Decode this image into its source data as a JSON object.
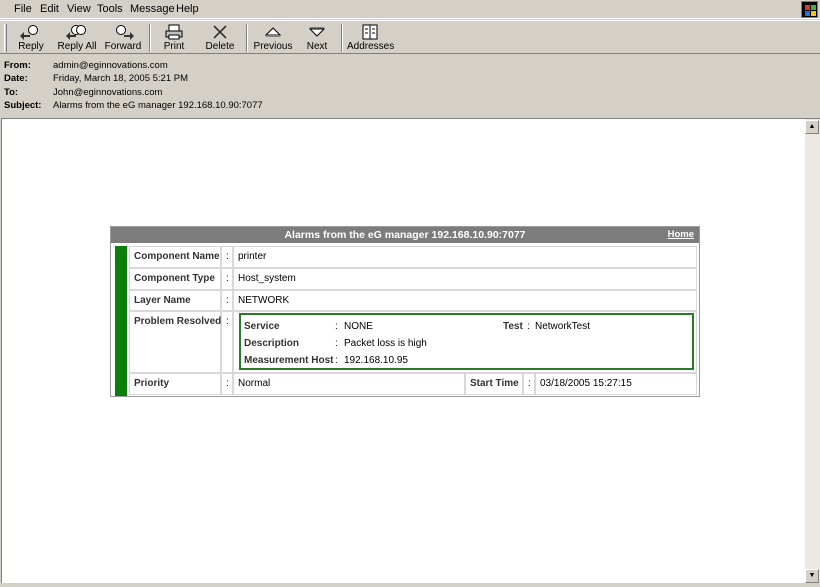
{
  "menu": [
    "File",
    "Edit",
    "View",
    "Tools",
    "Message",
    "Help"
  ],
  "toolbar": {
    "reply": "Reply",
    "reply_all": "Reply All",
    "forward": "Forward",
    "print": "Print",
    "delete": "Delete",
    "previous": "Previous",
    "next": "Next",
    "addresses": "Addresses"
  },
  "headers": {
    "from_label": "From:",
    "from": "admin@eginnovations.com",
    "date_label": "Date:",
    "date": "Friday, March 18, 2005 5:21 PM",
    "to_label": "To:",
    "to": "John@eginnovations.com",
    "subject_label": "Subject:",
    "subject": "Alarms from the eG manager 192.168.10.90:7077"
  },
  "alarm": {
    "title": "Alarms from the eG manager 192.168.10.90:7077",
    "home": "Home",
    "colon": ":",
    "component_name_label": "Component Name",
    "component_name": "printer",
    "component_type_label": "Component Type",
    "component_type": "Host_system",
    "layer_name_label": "Layer Name",
    "layer_name": "NETWORK",
    "problem_resolved_label": "Problem Resolved",
    "service_label": "Service",
    "service": "NONE",
    "test_label": "Test",
    "test": "NetworkTest",
    "description_label": "Description",
    "description": "Packet loss is high",
    "measurement_host_label": "Measurement Host",
    "measurement_host": "192.168.10.95",
    "priority_label": "Priority",
    "priority": "Normal",
    "start_time_label": "Start Time",
    "start_time": "03/18/2005 15:27:15"
  },
  "colors": {
    "status_green": "#0b7e0b",
    "title_bar": "#7c7c7c"
  },
  "icons": {
    "reply": "reply-icon",
    "reply_all": "reply-all-icon",
    "forward": "forward-icon",
    "print": "print-icon",
    "delete": "delete-icon",
    "previous": "previous-icon",
    "next": "next-icon",
    "addresses": "address-book-icon"
  }
}
